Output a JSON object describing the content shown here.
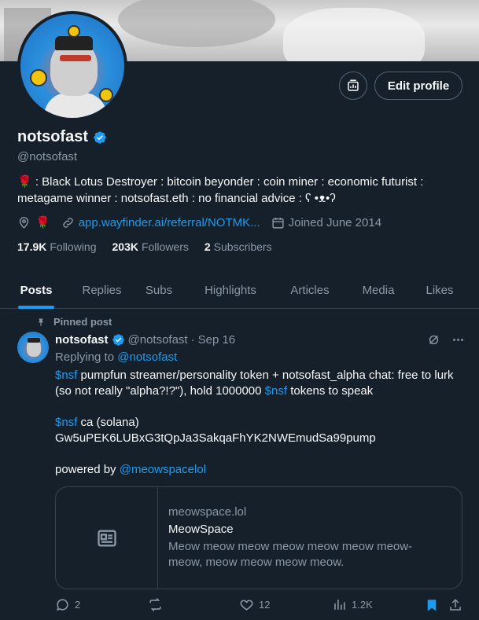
{
  "profile": {
    "display_name": "notsofast",
    "handle": "@notsofast",
    "bio": "🌹 : Black Lotus Destroyer : bitcoin beyonder : coin miner : economic futurist : metagame winner : notsofast.eth : no financial advice : ʕ •ᴥ•ʔ",
    "location": "🌹",
    "website": "app.wayfinder.ai/referral/NOTMK...",
    "joined": "Joined June 2014",
    "edit_profile_label": "Edit profile",
    "stats": {
      "following_count": "17.9K",
      "following_label": "Following",
      "followers_count": "203K",
      "followers_label": "Followers",
      "subscribers_count": "2",
      "subscribers_label": "Subscribers"
    }
  },
  "tabs": [
    {
      "label": "Posts"
    },
    {
      "label": "Replies"
    },
    {
      "label": "Subs"
    },
    {
      "label": "Highlights"
    },
    {
      "label": "Articles"
    },
    {
      "label": "Media"
    },
    {
      "label": "Likes"
    }
  ],
  "pinned_post": {
    "pinned_label": "Pinned post",
    "author_name": "notsofast",
    "author_handle": "@notsofast",
    "separator": "·",
    "date": "Sep 16",
    "replying_prefix": "Replying to",
    "replying_to": "@notsofast",
    "line1_cash": "$nsf",
    "line1_a": " pumpfun streamer/personality token + notsofast_alpha chat: free to lurk (so not really \"alpha?!?\"), hold 1000000 ",
    "line1_cash2": "$nsf",
    "line1_b": " tokens to speak",
    "line2_cash": "$nsf",
    "line2_a": " ca (solana)",
    "contract": "Gw5uPEK6LUBxG3tQpJa3SakqaFhYK2NWEmudSa99pump",
    "powered_prefix": "powered by ",
    "powered_link": "@meowspacelol",
    "card": {
      "domain": "meowspace.lol",
      "title": "MeowSpace",
      "description": "Meow meow meow meow meow meow meow-meow, meow meow meow meow."
    },
    "actions": {
      "replies": "2",
      "reposts": "",
      "likes": "12",
      "views": "1.2K"
    }
  },
  "colors": {
    "background": "#15202b",
    "accent": "#1d9bf0",
    "muted_text": "#8b98a5",
    "border": "#38444d"
  }
}
